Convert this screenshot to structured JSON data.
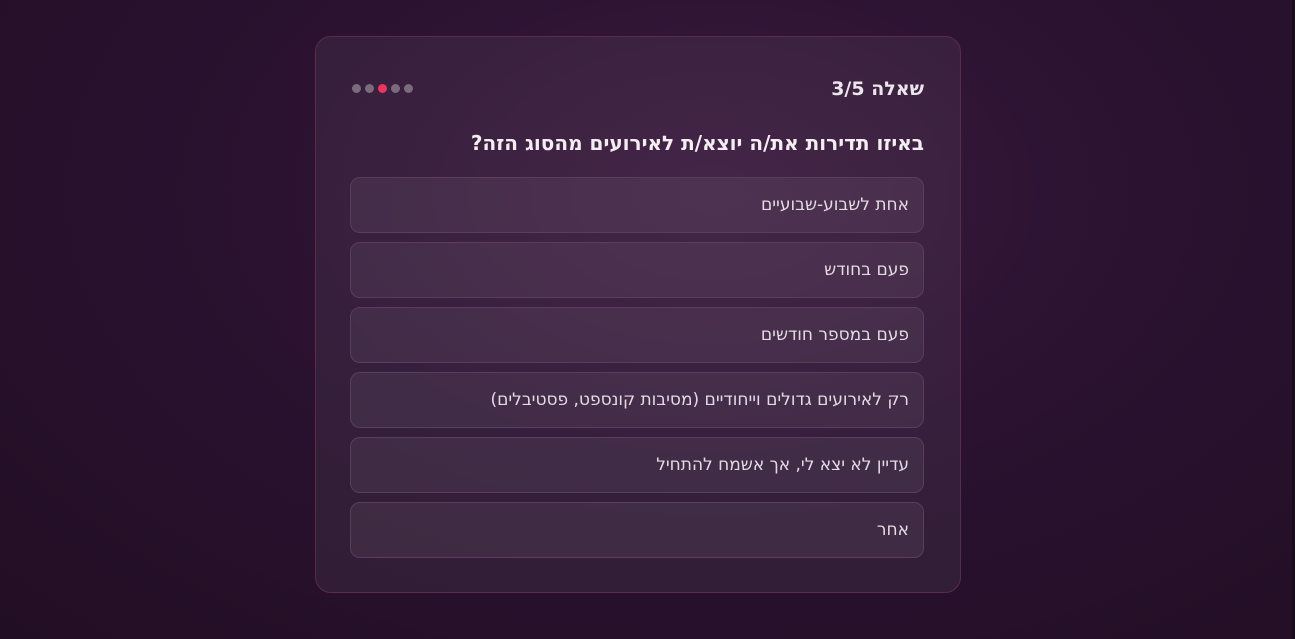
{
  "quiz": {
    "progress_label": "שאלה 3/5",
    "total_steps": 5,
    "current_step": 3,
    "question": "באיזו תדירות את/ה יוצא/ת לאירועים מהסוג הזה?",
    "options": [
      {
        "label": "אחת לשבוע-שבועיים"
      },
      {
        "label": "פעם בחודש"
      },
      {
        "label": "פעם במספר חודשים"
      },
      {
        "label": "רק לאירועים גדולים וייחודיים (מסיבות קונספט, פסטיבלים)"
      },
      {
        "label": "עדיין לא יצא לי, אך אשמח להתחיל"
      },
      {
        "label": "אחר"
      }
    ]
  },
  "colors": {
    "accent": "#e8365e",
    "inactive_dot": "#7a6a7c"
  }
}
